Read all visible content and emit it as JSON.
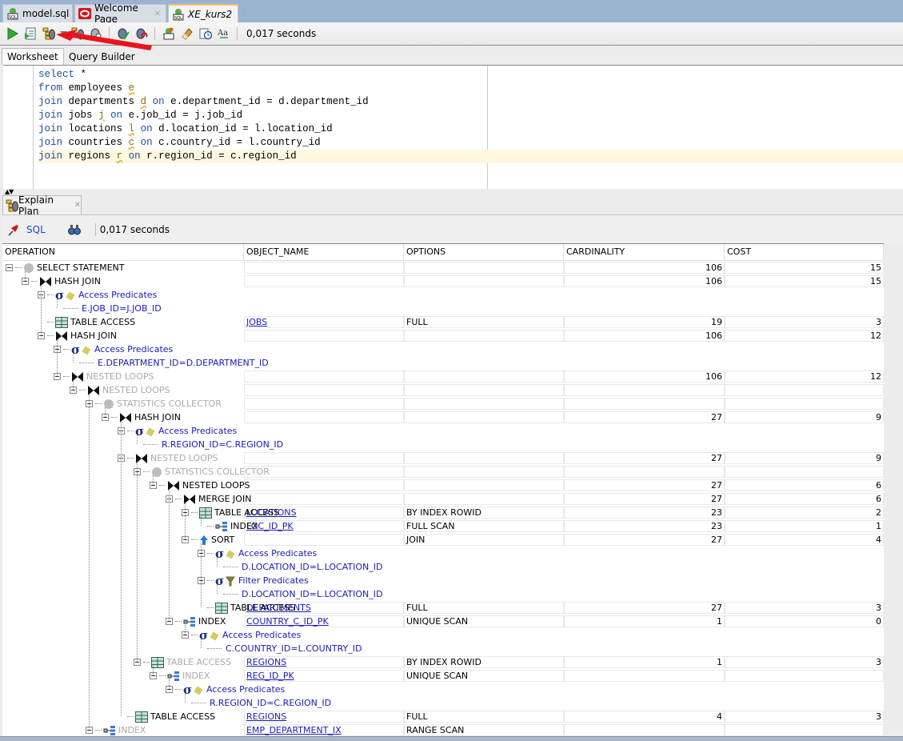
{
  "doc_tabs": [
    {
      "label": "model.sql",
      "icon": "sql-file-icon",
      "active": false
    },
    {
      "label": "Welcome Page",
      "icon": "oracle-logo-icon",
      "active": false
    },
    {
      "label": "XE_kurs2",
      "icon": "sql-connection-icon",
      "active": true
    }
  ],
  "toolbar": {
    "buttons": [
      {
        "name": "run-statement-button",
        "icon": "play-icon"
      },
      {
        "name": "run-script-button",
        "icon": "run-script-icon"
      },
      {
        "name": "explain-plan-button",
        "icon": "explain-plan-icon"
      },
      {
        "name": "explain-plan-dropdown",
        "icon": "chevron-down-icon"
      },
      {
        "name": "autotrace-button",
        "icon": "autotrace-icon"
      },
      {
        "name": "sql-tuning-advisor-button",
        "icon": "tuning-advisor-icon"
      },
      {
        "name": "commit-button",
        "icon": "commit-icon"
      },
      {
        "name": "rollback-button",
        "icon": "rollback-icon"
      },
      {
        "name": "unshared-sql-button",
        "icon": "unshared-sql-icon"
      },
      {
        "name": "clear-button",
        "icon": "eraser-icon"
      },
      {
        "name": "sql-history-button",
        "icon": "history-icon"
      },
      {
        "name": "format-case-button",
        "icon": "to-upper-lower-icon"
      }
    ],
    "elapsed": "0,017 seconds"
  },
  "sub_tabs": [
    {
      "label": "Worksheet",
      "active": true
    },
    {
      "label": "Query Builder",
      "active": false
    }
  ],
  "editor": {
    "lines": [
      [
        {
          "t": "select",
          "c": "kw"
        },
        {
          "t": " *",
          "c": ""
        }
      ],
      [
        {
          "t": "from",
          "c": "kw"
        },
        {
          "t": " employees ",
          "c": ""
        },
        {
          "t": "e",
          "c": "alias"
        }
      ],
      [
        {
          "t": "join",
          "c": "kw"
        },
        {
          "t": " departments ",
          "c": ""
        },
        {
          "t": "d",
          "c": "alias"
        },
        {
          "t": " ",
          "c": ""
        },
        {
          "t": "on",
          "c": "kw"
        },
        {
          "t": " e.department_id = d.department_id",
          "c": ""
        }
      ],
      [
        {
          "t": "join",
          "c": "kw"
        },
        {
          "t": " jobs ",
          "c": ""
        },
        {
          "t": "j",
          "c": "alias"
        },
        {
          "t": " ",
          "c": ""
        },
        {
          "t": "on",
          "c": "kw"
        },
        {
          "t": " e.job_id = j.job_id",
          "c": ""
        }
      ],
      [
        {
          "t": "join",
          "c": "kw"
        },
        {
          "t": " locations ",
          "c": ""
        },
        {
          "t": "l",
          "c": "alias"
        },
        {
          "t": " ",
          "c": ""
        },
        {
          "t": "on",
          "c": "kw"
        },
        {
          "t": " d.location_id = l.location_id",
          "c": ""
        }
      ],
      [
        {
          "t": "join",
          "c": "kw"
        },
        {
          "t": " countries ",
          "c": ""
        },
        {
          "t": "c",
          "c": "alias"
        },
        {
          "t": " ",
          "c": ""
        },
        {
          "t": "on",
          "c": "kw"
        },
        {
          "t": " c.country_id = l.country_id",
          "c": ""
        }
      ],
      [
        {
          "t": "join",
          "c": "kw"
        },
        {
          "t": " regions ",
          "c": ""
        },
        {
          "t": "r",
          "c": "alias"
        },
        {
          "t": " ",
          "c": ""
        },
        {
          "t": "on",
          "c": "kw"
        },
        {
          "t": " r.region_id = c.region_id",
          "c": ""
        }
      ]
    ],
    "current_line": 6
  },
  "explain_panel": {
    "tab_label": "Explain Plan",
    "sql_label": "SQL",
    "elapsed": "0,017 seconds",
    "columns": [
      "OPERATION",
      "OBJECT_NAME",
      "OPTIONS",
      "CARDINALITY",
      "COST"
    ],
    "rows": [
      {
        "depth": 0,
        "op": "SELECT STATEMENT",
        "icon": "statement",
        "toggle": true,
        "object": "",
        "options": "",
        "card": "106",
        "cost": "15"
      },
      {
        "depth": 1,
        "op": "HASH JOIN",
        "icon": "join",
        "toggle": true,
        "object": "",
        "options": "",
        "card": "106",
        "cost": "15"
      },
      {
        "depth": 2,
        "op": "Access Predicates",
        "icon": "access-pred",
        "toggle": true,
        "pred": true
      },
      {
        "depth": 3,
        "op": "E.JOB_ID=J.JOB_ID",
        "icon": "none",
        "toggle": false,
        "pred": true,
        "predtext": true
      },
      {
        "depth": 2,
        "op": "TABLE ACCESS",
        "icon": "table",
        "toggle": false,
        "object": "JOBS",
        "options": "FULL",
        "card": "19",
        "cost": "3"
      },
      {
        "depth": 2,
        "op": "HASH JOIN",
        "icon": "join",
        "toggle": true,
        "object": "",
        "options": "",
        "card": "106",
        "cost": "12"
      },
      {
        "depth": 3,
        "op": "Access Predicates",
        "icon": "access-pred",
        "toggle": true,
        "pred": true
      },
      {
        "depth": 4,
        "op": "E.DEPARTMENT_ID=D.DEPARTMENT_ID",
        "icon": "none",
        "toggle": false,
        "pred": true,
        "predtext": true
      },
      {
        "depth": 3,
        "op": "NESTED LOOPS",
        "icon": "join",
        "toggle": true,
        "dim": true,
        "object": "",
        "options": "",
        "card": "106",
        "cost": "12"
      },
      {
        "depth": 4,
        "op": "NESTED LOOPS",
        "icon": "join",
        "toggle": true,
        "dim": true,
        "object": "",
        "options": "",
        "card": "",
        "cost": ""
      },
      {
        "depth": 5,
        "op": "STATISTICS COLLECTOR",
        "icon": "statement",
        "toggle": true,
        "dim": true,
        "object": "",
        "options": "",
        "card": "",
        "cost": ""
      },
      {
        "depth": 6,
        "op": "HASH JOIN",
        "icon": "join",
        "toggle": true,
        "object": "",
        "options": "",
        "card": "27",
        "cost": "9"
      },
      {
        "depth": 7,
        "op": "Access Predicates",
        "icon": "access-pred",
        "toggle": true,
        "pred": true
      },
      {
        "depth": 8,
        "op": "R.REGION_ID=C.REGION_ID",
        "icon": "none",
        "toggle": false,
        "pred": true,
        "predtext": true
      },
      {
        "depth": 7,
        "op": "NESTED LOOPS",
        "icon": "join",
        "toggle": true,
        "dim": true,
        "object": "",
        "options": "",
        "card": "27",
        "cost": "9"
      },
      {
        "depth": 8,
        "op": "STATISTICS COLLECTOR",
        "icon": "statement",
        "toggle": true,
        "dim": true,
        "object": "",
        "options": "",
        "card": "",
        "cost": ""
      },
      {
        "depth": 9,
        "op": "NESTED LOOPS",
        "icon": "join",
        "toggle": true,
        "object": "",
        "options": "",
        "card": "27",
        "cost": "6"
      },
      {
        "depth": 10,
        "op": "MERGE JOIN",
        "icon": "join",
        "toggle": true,
        "object": "",
        "options": "",
        "card": "27",
        "cost": "6"
      },
      {
        "depth": 11,
        "op": "TABLE ACCESS",
        "icon": "table",
        "toggle": true,
        "object": "LOCATIONS",
        "options": "BY INDEX ROWID",
        "card": "23",
        "cost": "2"
      },
      {
        "depth": 12,
        "op": "INDEX",
        "icon": "index",
        "toggle": false,
        "object": "LOC_ID_PK",
        "options": "FULL SCAN",
        "card": "23",
        "cost": "1"
      },
      {
        "depth": 11,
        "op": "SORT",
        "icon": "sort",
        "toggle": true,
        "object": "",
        "options": "JOIN",
        "card": "27",
        "cost": "4"
      },
      {
        "depth": 12,
        "op": "Access Predicates",
        "icon": "access-pred",
        "toggle": true,
        "pred": true
      },
      {
        "depth": 13,
        "op": "D.LOCATION_ID=L.LOCATION_ID",
        "icon": "none",
        "toggle": false,
        "pred": true,
        "predtext": true
      },
      {
        "depth": 12,
        "op": "Filter Predicates",
        "icon": "filter-pred",
        "toggle": true,
        "pred": true
      },
      {
        "depth": 13,
        "op": "D.LOCATION_ID=L.LOCATION_ID",
        "icon": "none",
        "toggle": false,
        "pred": true,
        "predtext": true
      },
      {
        "depth": 12,
        "op": "TABLE ACCESS",
        "icon": "table",
        "toggle": false,
        "object": "DEPARTMENTS",
        "options": "FULL",
        "card": "27",
        "cost": "3"
      },
      {
        "depth": 10,
        "op": "INDEX",
        "icon": "index",
        "toggle": true,
        "object": "COUNTRY_C_ID_PK",
        "options": "UNIQUE SCAN",
        "card": "1",
        "cost": "0"
      },
      {
        "depth": 11,
        "op": "Access Predicates",
        "icon": "access-pred",
        "toggle": true,
        "pred": true
      },
      {
        "depth": 12,
        "op": "C.COUNTRY_ID=L.COUNTRY_ID",
        "icon": "none",
        "toggle": false,
        "pred": true,
        "predtext": true
      },
      {
        "depth": 8,
        "op": "TABLE ACCESS",
        "icon": "table",
        "toggle": true,
        "dim": true,
        "object": "REGIONS",
        "options": "BY INDEX ROWID",
        "card": "1",
        "cost": "3"
      },
      {
        "depth": 9,
        "op": "INDEX",
        "icon": "index",
        "toggle": true,
        "dim": true,
        "object": "REG_ID_PK",
        "options": "UNIQUE SCAN",
        "card": "",
        "cost": ""
      },
      {
        "depth": 10,
        "op": "Access Predicates",
        "icon": "access-pred",
        "toggle": true,
        "pred": true
      },
      {
        "depth": 11,
        "op": "R.REGION_ID=C.REGION_ID",
        "icon": "none",
        "toggle": false,
        "pred": true,
        "predtext": true
      },
      {
        "depth": 7,
        "op": "TABLE ACCESS",
        "icon": "table",
        "toggle": false,
        "object": "REGIONS",
        "options": "FULL",
        "card": "4",
        "cost": "3"
      },
      {
        "depth": 5,
        "op": "INDEX",
        "icon": "index",
        "toggle": true,
        "dim": true,
        "object": "EMP_DEPARTMENT_IX",
        "options": "RANGE SCAN",
        "card": "",
        "cost": ""
      }
    ]
  },
  "colors": {
    "tab_strip": "#9ab4d0",
    "active_tab_accent": "#f3c26b",
    "link_blue": "#1a1ab5",
    "keyword_blue": "#1b4d9b",
    "current_line": "#fff7e2",
    "annotation_arrow": "#e8141b"
  }
}
